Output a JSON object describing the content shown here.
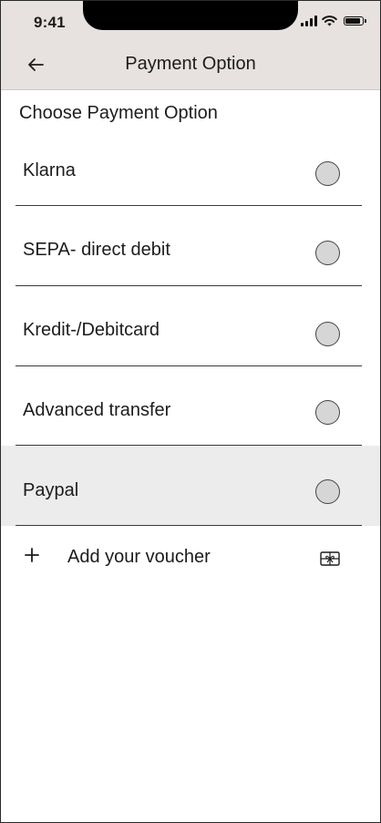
{
  "status_bar": {
    "time": "9:41"
  },
  "header": {
    "title": "Payment Option",
    "back_icon": "arrow-left-icon"
  },
  "section": {
    "title": "Choose Payment Option"
  },
  "options": [
    {
      "label": "Klarna",
      "selected": false,
      "highlighted": false
    },
    {
      "label": "SEPA- direct debit",
      "selected": false,
      "highlighted": false
    },
    {
      "label": "Kredit-/Debitcard",
      "selected": false,
      "highlighted": false
    },
    {
      "label": "Advanced transfer",
      "selected": false,
      "highlighted": false
    },
    {
      "label": "Paypal",
      "selected": false,
      "highlighted": true
    }
  ],
  "voucher": {
    "label": "Add your voucher",
    "icon": "gift-card-icon",
    "add_icon": "plus-icon"
  },
  "colors": {
    "header_bg": "#e7e1df",
    "highlight_bg": "#ececec",
    "radio_fill": "#d6d6d6"
  }
}
